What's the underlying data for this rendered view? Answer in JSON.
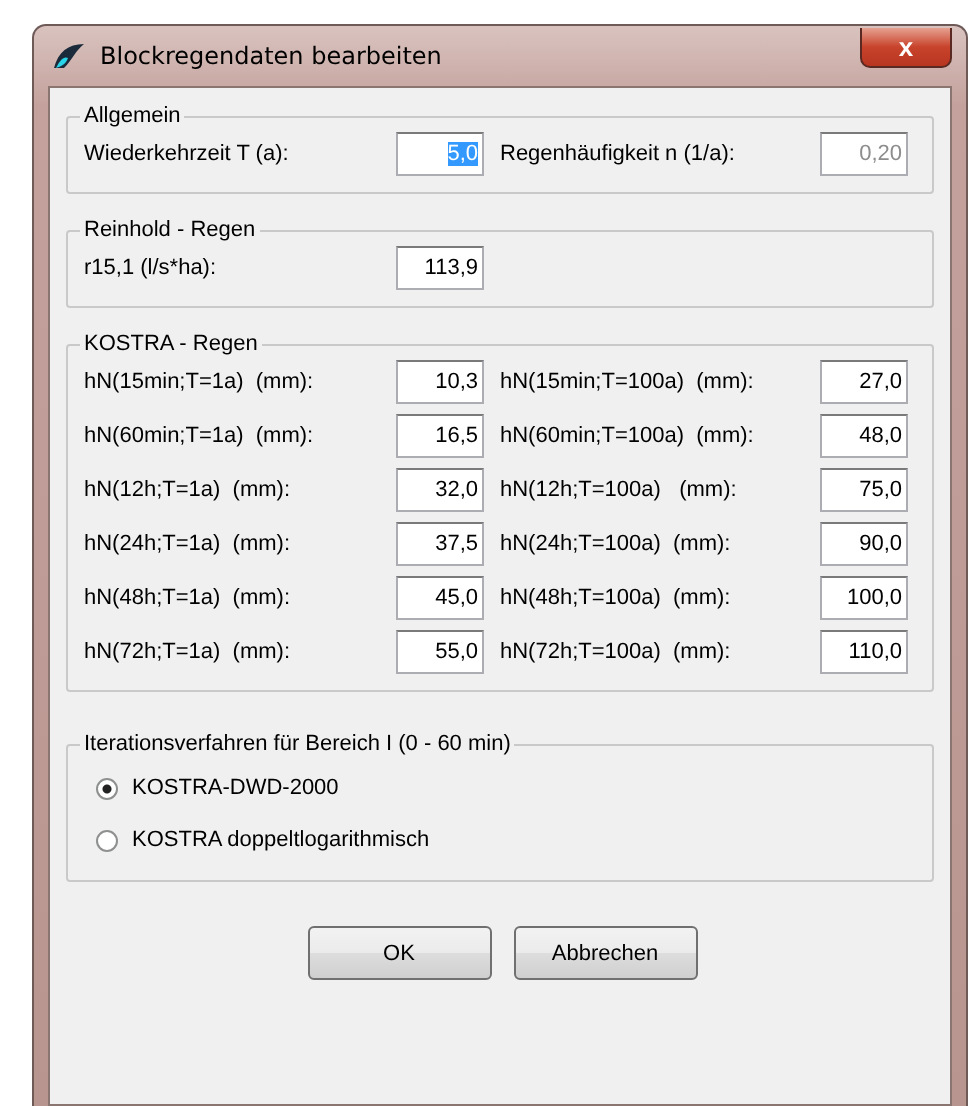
{
  "window": {
    "title": "Blockregendaten bearbeiten",
    "close": "x"
  },
  "allgemein": {
    "title": "Allgemein",
    "fields": [
      {
        "label": "Wiederkehrzeit T (a):",
        "value": "5,0",
        "selected": true,
        "disabled": false
      },
      {
        "label": "Regenhäufigkeit n (1/a):",
        "value": "0,20",
        "selected": false,
        "disabled": true
      }
    ]
  },
  "reinhold": {
    "title": "Reinhold - Regen",
    "fields": [
      {
        "label": "r15,1 (l/s*ha):",
        "value": "113,9"
      }
    ]
  },
  "kostra": {
    "title": "KOSTRA - Regen",
    "fields": [
      {
        "label": "hN(15min;T=1a)  (mm):",
        "value": "10,3"
      },
      {
        "label": "hN(15min;T=100a)  (mm):",
        "value": "27,0"
      },
      {
        "label": "hN(60min;T=1a)  (mm):",
        "value": "16,5"
      },
      {
        "label": "hN(60min;T=100a)  (mm):",
        "value": "48,0"
      },
      {
        "label": "hN(12h;T=1a)  (mm):",
        "value": "32,0"
      },
      {
        "label": "hN(12h;T=100a)   (mm):",
        "value": "75,0"
      },
      {
        "label": "hN(24h;T=1a)  (mm):",
        "value": "37,5"
      },
      {
        "label": "hN(24h;T=100a)  (mm):",
        "value": "90,0"
      },
      {
        "label": "hN(48h;T=1a)  (mm):",
        "value": "45,0"
      },
      {
        "label": "hN(48h;T=100a)  (mm):",
        "value": "100,0"
      },
      {
        "label": "hN(72h;T=1a)  (mm):",
        "value": "55,0"
      },
      {
        "label": "hN(72h;T=100a)  (mm):",
        "value": "110,0"
      }
    ]
  },
  "iteration": {
    "title": "Iterationsverfahren für Bereich I (0 - 60 min)",
    "options": [
      {
        "label": "KOSTRA-DWD-2000",
        "selected": true
      },
      {
        "label": "KOSTRA doppeltlogarithmisch",
        "selected": false
      }
    ]
  },
  "buttons": [
    "OK",
    "Abbrechen"
  ]
}
